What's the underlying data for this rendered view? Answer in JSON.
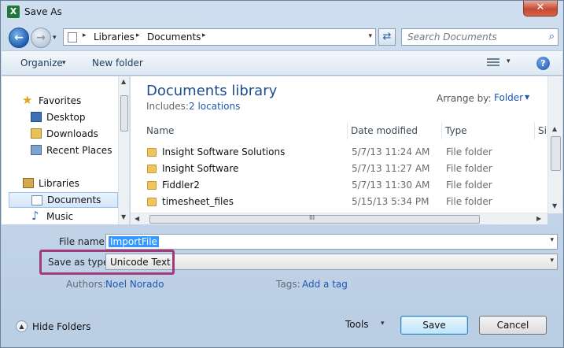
{
  "window": {
    "title": "Save As",
    "app_icon_letter": "X",
    "close_glyph": "✕"
  },
  "nav": {
    "back_glyph": "←",
    "forward_glyph": "→",
    "dropdown_glyph": "▾"
  },
  "address": {
    "breadcrumbs": [
      "Libraries",
      "Documents"
    ],
    "separator": "▸",
    "dropdown_glyph": "▾",
    "refresh_glyph": "⇄"
  },
  "search": {
    "placeholder": "Search Documents",
    "icon_glyph": "⌕"
  },
  "toolbar": {
    "organize_label": "Organize",
    "organize_dd": "▾",
    "new_folder_label": "New folder",
    "views_dd": "▾",
    "help_glyph": "?"
  },
  "sidebar": {
    "items": [
      {
        "label": "Favorites",
        "icon": "star-icon"
      },
      {
        "label": "Desktop",
        "icon": "desktop-icon"
      },
      {
        "label": "Downloads",
        "icon": "downloads-icon"
      },
      {
        "label": "Recent Places",
        "icon": "recent-places-icon"
      },
      {
        "label": "Libraries",
        "icon": "libraries-icon"
      },
      {
        "label": "Documents",
        "icon": "documents-icon",
        "selected": true
      },
      {
        "label": "Music",
        "icon": "music-icon"
      }
    ],
    "star_glyph": "★",
    "music_glyph": "♪",
    "scroll_up": "▲",
    "scroll_down": "▼"
  },
  "library": {
    "title": "Documents library",
    "includes_label": "Includes:",
    "includes_link": "2 locations",
    "arrange_label": "Arrange by:",
    "arrange_value": "Folder",
    "arrange_dd": "▼"
  },
  "columns": [
    "Name",
    "Date modified",
    "Type",
    "Si"
  ],
  "files": [
    {
      "name": "Insight Software Solutions",
      "date": "5/7/13 11:24 AM",
      "type": "File folder"
    },
    {
      "name": "Insight Software",
      "date": "5/7/13 11:27 AM",
      "type": "File folder"
    },
    {
      "name": "Fiddler2",
      "date": "5/7/13 11:30 AM",
      "type": "File folder"
    },
    {
      "name": "timesheet_files",
      "date": "5/15/13 5:34 PM",
      "type": "File folder"
    }
  ],
  "scroll": {
    "up": "▲",
    "down": "▼",
    "left": "◀",
    "right": "▶",
    "grip": "III"
  },
  "form": {
    "file_name_label": "File name:",
    "file_name_value": "ImportFile",
    "save_type_label": "Save as type:",
    "save_type_value": "Unicode Text",
    "dropdown_glyph": "▾",
    "authors_label": "Authors:",
    "authors_value": "Noel Norado",
    "tags_label": "Tags:",
    "tags_value": "Add a tag"
  },
  "footer": {
    "hide_folders_label": "Hide Folders",
    "hide_folders_glyph": "▲",
    "tools_label": "Tools",
    "tools_dd": "▾",
    "save_label": "Save",
    "cancel_label": "Cancel"
  },
  "colors": {
    "accent": "#1f57b3",
    "highlight_box": "#a3387a",
    "selection": "#3399ff"
  }
}
